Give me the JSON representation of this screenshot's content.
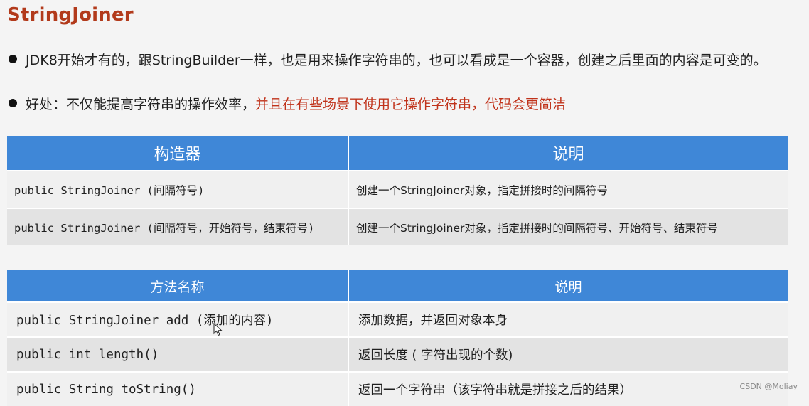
{
  "title": "StringJoiner",
  "bullets": {
    "first": "JDK8开始才有的，跟StringBuilder一样，也是用来操作字符串的，也可以看成是一个容器，创建之后里面的内容是可变的。",
    "second_plain": "好处：不仅能提高字符串的操作效率，",
    "second_red": "并且在有些场景下使用它操作字符串，代码会更简洁"
  },
  "constructors_table": {
    "headers": [
      "构造器",
      "说明"
    ],
    "rows": [
      {
        "signature": "public StringJoiner (间隔符号)",
        "description": "创建一个StringJoiner对象，指定拼接时的间隔符号"
      },
      {
        "signature": "public StringJoiner (间隔符号，开始符号，结束符号)",
        "description": "创建一个StringJoiner对象，指定拼接时的间隔符号、开始符号、结束符号"
      }
    ]
  },
  "methods_table": {
    "headers": [
      "方法名称",
      "说明"
    ],
    "rows": [
      {
        "signature": "public StringJoiner add (添加的内容)",
        "description": "添加数据，并返回对象本身"
      },
      {
        "signature": "public int length()",
        "description": "返回长度 ( 字符出现的个数)"
      },
      {
        "signature": "public String toString()",
        "description": "返回一个字符串（该字符串就是拼接之后的结果）"
      }
    ]
  },
  "watermark": "CSDN @Moliay",
  "colors": {
    "title": "#b23a1b",
    "highlight": "#c0321a",
    "header_bg": "#3f87d7",
    "row_light": "#f0f0f0",
    "row_dark": "#e3e3e3"
  }
}
